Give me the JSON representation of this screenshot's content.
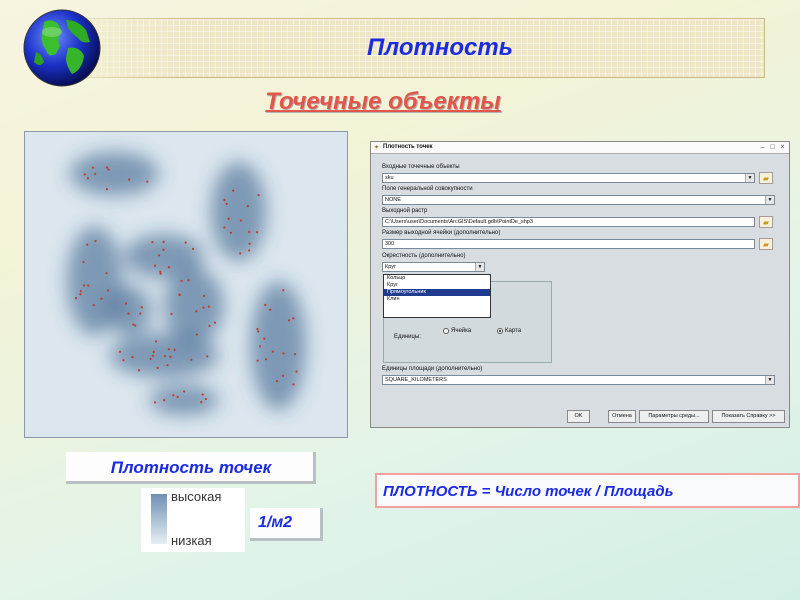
{
  "header": {
    "title": "Плотность",
    "subtitle": "Точечные объекты"
  },
  "map": {
    "colors": {
      "background": "#d9e5ec",
      "high": "#2f5a85",
      "points": "#c0392b"
    }
  },
  "dialog": {
    "title": "Плотность точек",
    "input_points_label": "Входные точечные объекты",
    "input_points_value": "sku",
    "population_field_label": "Поле генеральной совокупности",
    "population_field_value": "NONE",
    "output_raster_label": "Выходной растр",
    "output_raster_value": "C:\\Users\\user\\Documents\\ArcGIS\\Default.gdb\\PointDe_shp3",
    "cell_size_label": "Размер выходной ячейки (дополнительно)",
    "cell_size_value": "300",
    "neighborhood_label": "Окрестность (дополнительно)",
    "neighborhood_value": "Круг",
    "neighborhood_options": [
      "Кольцо",
      "Круг",
      "Прямоугольник",
      "Клин"
    ],
    "neighborhood_selected_index": 2,
    "units_label": "Единицы:",
    "units_cell": "Ячейка",
    "units_map": "Карта",
    "area_units_label": "Единицы площади (дополнительно)",
    "area_units_value": "SQUARE_KILOMETERS",
    "ok": "OK",
    "cancel": "Отмена",
    "env": "Параметры среды...",
    "help": "Показать Справку >>"
  },
  "legend": {
    "title": "Плотность  точек",
    "high": "высокая",
    "low": "низкая",
    "unit": "1/м2"
  },
  "formula": "ПЛОТНОСТЬ = Число точек / Площадь"
}
